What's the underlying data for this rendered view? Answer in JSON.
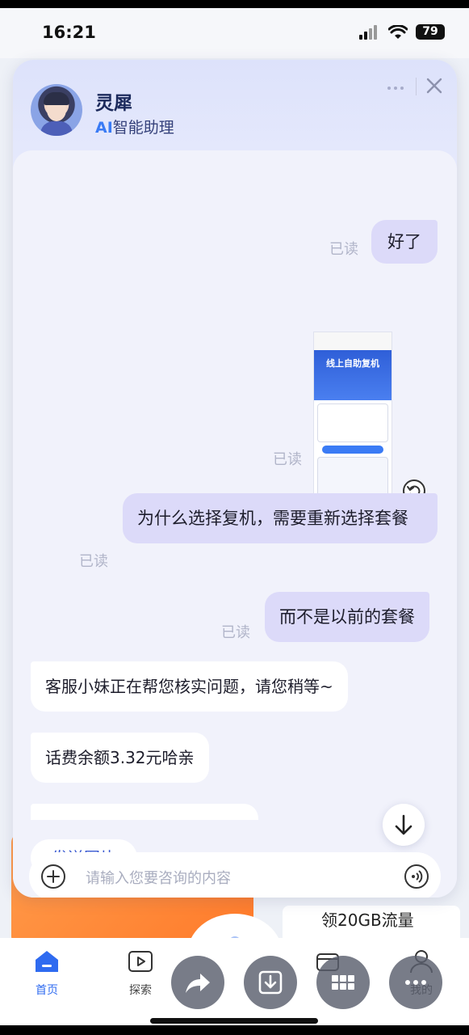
{
  "status_bar": {
    "time": "16:21",
    "battery": "79"
  },
  "chat_header": {
    "bot_name": "灵犀",
    "subtitle_ai": "AI",
    "subtitle_rest": "智能助理"
  },
  "messages": {
    "read_label": "已读",
    "msg1": "好了",
    "screenshot_title": "线上自助复机",
    "msg3": "为什么选择复机，需要重新选择套餐",
    "msg4": "而不是以前的套餐",
    "reply1": "客服小妹正在帮您核实问题，请您稍等~",
    "reply2": "话费余额3.32元哈亲"
  },
  "actions": {
    "send_image": "发送图片"
  },
  "input": {
    "placeholder": "请输入您要咨询的内容"
  },
  "background": {
    "promo_text": "领20GB流量"
  },
  "tabbar": {
    "home": "首页",
    "explore": "探索",
    "mine": "我的"
  },
  "colors": {
    "accent": "#2f6bf0",
    "bubble_out": "#dcdaf9",
    "link": "#3a5ad1"
  }
}
